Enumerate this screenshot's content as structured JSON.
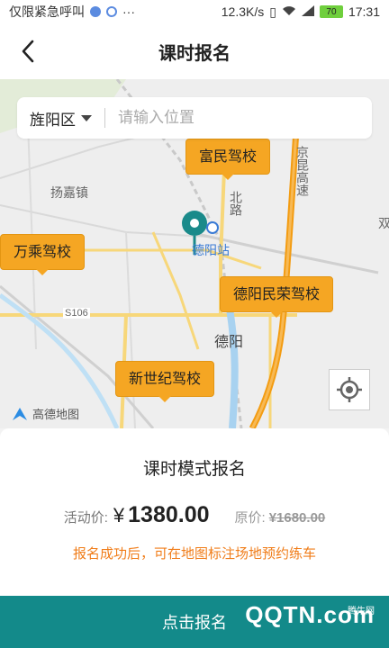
{
  "status_bar": {
    "carrier": "仅限紧急呼叫",
    "speed": "12.3K/s",
    "battery": "70",
    "time": "17:31"
  },
  "nav": {
    "title": "课时报名",
    "back_icon": "chevron-left-icon"
  },
  "search": {
    "region": "旌阳区",
    "placeholder": "请输入位置"
  },
  "map": {
    "place_labels": [
      "扬嘉镇",
      "德阳站",
      "德阳",
      "北路",
      "京昆高速",
      "S106",
      "双"
    ],
    "schools": [
      "富民驾校",
      "万乘驾校",
      "德阳民荣驾校",
      "新世纪驾校"
    ],
    "provider": "高德地图",
    "pin_color": "#1a8a8a",
    "tag_color": "#f5a623"
  },
  "sheet": {
    "title": "课时模式报名",
    "price_label": "活动价:",
    "currency": "¥",
    "price": "1380.00",
    "original_label": "原价:",
    "original_price": "¥1680.00",
    "notice": "报名成功后，可在地图标注场地预约练车"
  },
  "cta": {
    "label": "点击报名"
  },
  "watermark": {
    "text": "QQTN.com",
    "small": "腾牛网"
  }
}
